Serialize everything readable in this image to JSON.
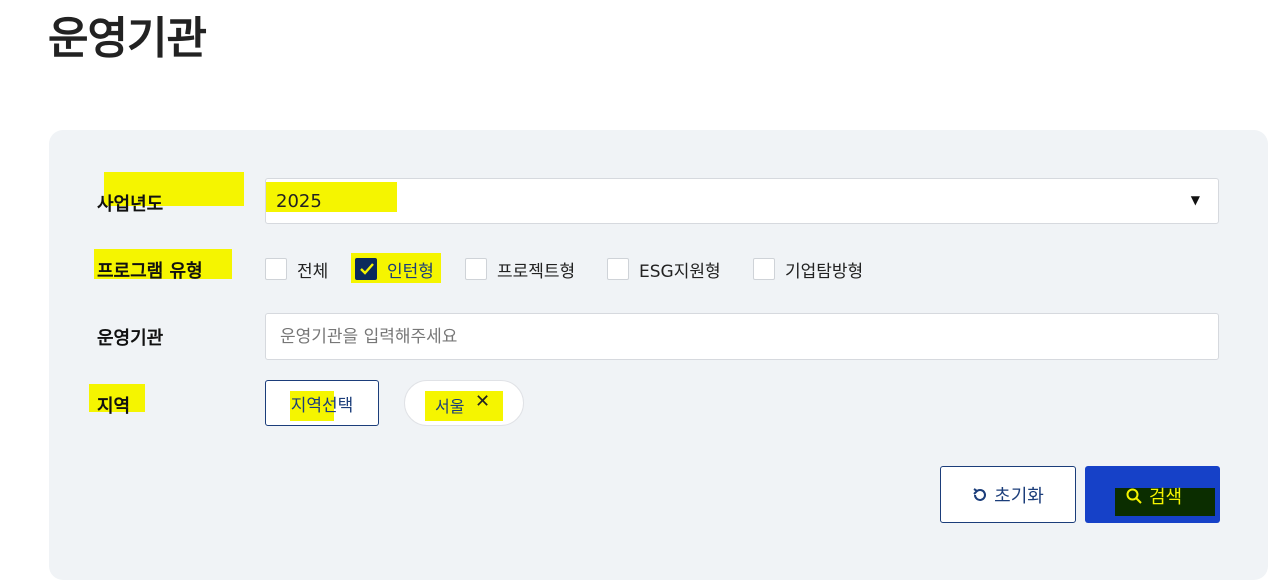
{
  "page": {
    "title": "운영기관"
  },
  "filters": {
    "year": {
      "label": "사업년도",
      "value": "2025"
    },
    "program_type": {
      "label": "프로그램 유형",
      "options": [
        {
          "label": "전체",
          "checked": false
        },
        {
          "label": "인턴형",
          "checked": true
        },
        {
          "label": "프로젝트형",
          "checked": false
        },
        {
          "label": "ESG지원형",
          "checked": false
        },
        {
          "label": "기업탐방형",
          "checked": false
        }
      ]
    },
    "org": {
      "label": "운영기관",
      "placeholder": "운영기관을 입력해주세요",
      "value": ""
    },
    "region": {
      "label": "지역",
      "select_button": "지역선택",
      "chips": [
        {
          "label": "서울",
          "close": "✕"
        }
      ]
    }
  },
  "actions": {
    "reset_label": "초기화",
    "search_label": "검색"
  },
  "colors": {
    "primary": "#1641c8",
    "navy": "#1b3d7a",
    "highlight": "#f5f500",
    "panel_bg": "#f0f3f6"
  },
  "icons": {
    "reset": "refresh-icon",
    "search": "search-icon",
    "caret": "caret-down-icon",
    "check": "check-icon",
    "close": "close-icon"
  }
}
